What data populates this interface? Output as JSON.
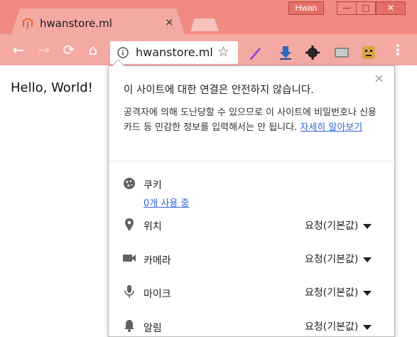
{
  "window": {
    "profile_name": "Hwan",
    "minimize": "—",
    "maximize": "□",
    "close": "✕"
  },
  "tab": {
    "title": "hwanstore.ml",
    "close": "×"
  },
  "toolbar": {
    "back": "←",
    "forward": "→",
    "reload": "⟳",
    "home": "⌂",
    "menu": "⋮"
  },
  "omnibox": {
    "url": "hwanstore.ml",
    "star": "☆"
  },
  "page": {
    "text": "Hello, World!"
  },
  "bubble": {
    "title": "이 사이트에 대한 연결은 안전하지 않습니다.",
    "close": "×",
    "body": "공격자에 의해 도난당할 수 있으므로 이 사이트에 비밀번호나 신용카드 등 민감한 정보를 입력해서는 안 됩니다.",
    "learn_more": "자세히 알아보기",
    "cookies": {
      "label": "쿠키",
      "link": "0개 사용 중"
    },
    "permissions": [
      {
        "label": "위치",
        "value": "요청(기본값)"
      },
      {
        "label": "카메라",
        "value": "요청(기본값)"
      },
      {
        "label": "마이크",
        "value": "요청(기본값)"
      },
      {
        "label": "알림",
        "value": "요청(기본값)"
      }
    ]
  },
  "colors": {
    "frame": "#f08a82",
    "toolbar": "#f4a9a3",
    "link": "#3367d6"
  }
}
